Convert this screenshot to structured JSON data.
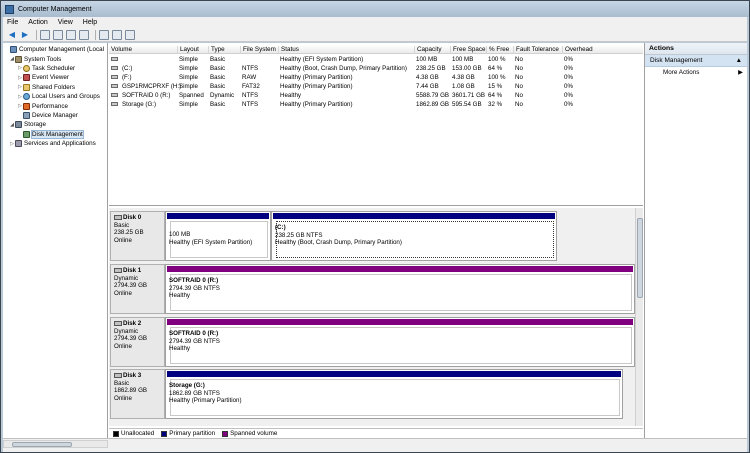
{
  "window": {
    "title": "Computer Management"
  },
  "menu": [
    "File",
    "Action",
    "View",
    "Help"
  ],
  "tree": [
    {
      "label": "Computer Management (Local",
      "level": 0,
      "icon": "computer-icon"
    },
    {
      "label": "System Tools",
      "level": 1,
      "icon": "tools-icon"
    },
    {
      "label": "Task Scheduler",
      "level": 2,
      "icon": "clock-icon"
    },
    {
      "label": "Event Viewer",
      "level": 2,
      "icon": "event-icon"
    },
    {
      "label": "Shared Folders",
      "level": 2,
      "icon": "folder-icon"
    },
    {
      "label": "Local Users and Groups",
      "level": 2,
      "icon": "users-icon"
    },
    {
      "label": "Performance",
      "level": 2,
      "icon": "performance-icon"
    },
    {
      "label": "Device Manager",
      "level": 2,
      "icon": "device-icon"
    },
    {
      "label": "Storage",
      "level": 1,
      "icon": "storage-icon"
    },
    {
      "label": "Disk Management",
      "level": 2,
      "icon": "disk-icon"
    },
    {
      "label": "Services and Applications",
      "level": 1,
      "icon": "services-icon"
    }
  ],
  "volumes": {
    "headers": [
      "Volume",
      "Layout",
      "Type",
      "File System",
      "Status",
      "Capacity",
      "Free Space",
      "% Free",
      "Fault Tolerance",
      "Overhead"
    ],
    "rows": [
      [
        "",
        "Simple",
        "Basic",
        "",
        "Healthy (EFI System Partition)",
        "100 MB",
        "100 MB",
        "100 %",
        "No",
        "0%"
      ],
      [
        "(C:)",
        "Simple",
        "Basic",
        "NTFS",
        "Healthy (Boot, Crash Dump, Primary Partition)",
        "238.25 GB",
        "153.00 GB",
        "64 %",
        "No",
        "0%"
      ],
      [
        "(F:)",
        "Simple",
        "Basic",
        "RAW",
        "Healthy (Primary Partition)",
        "4.38 GB",
        "4.38 GB",
        "100 %",
        "No",
        "0%"
      ],
      [
        "GSP1RMCPRXF (H:)",
        "Simple",
        "Basic",
        "FAT32",
        "Healthy (Primary Partition)",
        "7.44 GB",
        "1.08 GB",
        "15 %",
        "No",
        "0%"
      ],
      [
        "SOFTRAID 0 (R:)",
        "Spanned",
        "Dynamic",
        "NTFS",
        "Healthy",
        "5588.79 GB",
        "3601.71 GB",
        "64 %",
        "No",
        "0%"
      ],
      [
        "Storage (G:)",
        "Simple",
        "Basic",
        "NTFS",
        "Healthy (Primary Partition)",
        "1862.89 GB",
        "595.54 GB",
        "32 %",
        "No",
        "0%"
      ]
    ]
  },
  "disks": [
    {
      "name": "Disk 0",
      "type": "Basic",
      "size": "238.25 GB",
      "status": "Online",
      "partitions": [
        {
          "name": "",
          "size": "100 MB",
          "status": "Healthy (EFI System Partition)",
          "color": "#000080"
        },
        {
          "name": "(C:)",
          "size": "238.25 GB NTFS",
          "status": "Healthy (Boot, Crash Dump, Primary Partition)",
          "color": "#000080"
        }
      ]
    },
    {
      "name": "Disk 1",
      "type": "Dynamic",
      "size": "2794.39 GB",
      "status": "Online",
      "partitions": [
        {
          "name": "SOFTRAID 0  (R:)",
          "size": "2794.39 GB NTFS",
          "status": "Healthy",
          "color": "#800080"
        }
      ]
    },
    {
      "name": "Disk 2",
      "type": "Dynamic",
      "size": "2794.39 GB",
      "status": "Online",
      "partitions": [
        {
          "name": "SOFTRAID 0  (R:)",
          "size": "2794.39 GB NTFS",
          "status": "Healthy",
          "color": "#800080"
        }
      ]
    },
    {
      "name": "Disk 3",
      "type": "Basic",
      "size": "1862.89 GB",
      "status": "Online",
      "partitions": [
        {
          "name": "Storage  (G:)",
          "size": "1862.89 GB NTFS",
          "status": "Healthy (Primary Partition)",
          "color": "#000080"
        }
      ]
    }
  ],
  "legend": [
    {
      "label": "Unallocated",
      "color": "#000000"
    },
    {
      "label": "Primary partition",
      "color": "#000080"
    },
    {
      "label": "Spanned volume",
      "color": "#800080"
    }
  ],
  "actions": {
    "header": "Actions",
    "selected": "Disk Management",
    "items": [
      "More Actions"
    ]
  }
}
